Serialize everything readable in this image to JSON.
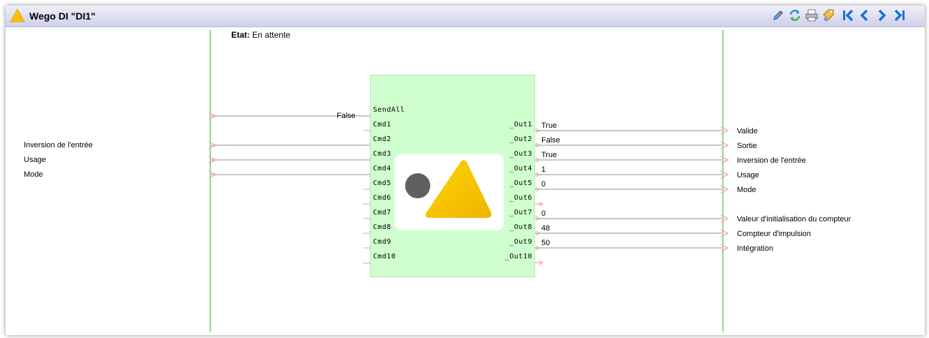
{
  "window": {
    "title": "Wego DI \"DI1\""
  },
  "toolbar": {
    "icons": [
      "edit-icon",
      "refresh-icon",
      "print-icon",
      "tag-icon",
      "first-page-icon",
      "previous-icon",
      "next-icon",
      "last-page-icon"
    ]
  },
  "status": {
    "label": "Etat:",
    "value": "En attente"
  },
  "block": {
    "inputs": [
      "SendAll",
      "Cmd1",
      "Cmd2",
      "Cmd3",
      "Cmd4",
      "Cmd5",
      "Cmd6",
      "Cmd7",
      "Cmd8",
      "Cmd9",
      "Cmd10"
    ],
    "outputs": [
      "_Out1",
      "_Out2",
      "_Out3",
      "_Out4",
      "_Out5",
      "_Out6",
      "_Out7",
      "_Out8",
      "_Out9",
      "_Out10"
    ]
  },
  "left_labels": {
    "sendall_value": "False",
    "cmd2": "Inversion de l'entrée",
    "cmd3": "Usage",
    "cmd4": "Mode"
  },
  "outputs": [
    {
      "value": "True",
      "label": "Valide"
    },
    {
      "value": "False",
      "label": "Sortie"
    },
    {
      "value": "True",
      "label": "Inversion de l'entrée"
    },
    {
      "value": "1",
      "label": "Usage"
    },
    {
      "value": "0",
      "label": "Mode"
    },
    {
      "value": "",
      "label": ""
    },
    {
      "value": "0",
      "label": "Valeur d'initialisation du compteur"
    },
    {
      "value": "48",
      "label": "Compteur d'impulsion"
    },
    {
      "value": "50",
      "label": "Intégration"
    },
    {
      "value": "",
      "label": ""
    }
  ],
  "colors": {
    "rail": "#88dd88",
    "block_bg": "#cfffcf",
    "wire": "#c8c8c8",
    "arrow": "#f4a8b0",
    "accent": "#1a6fd6"
  }
}
